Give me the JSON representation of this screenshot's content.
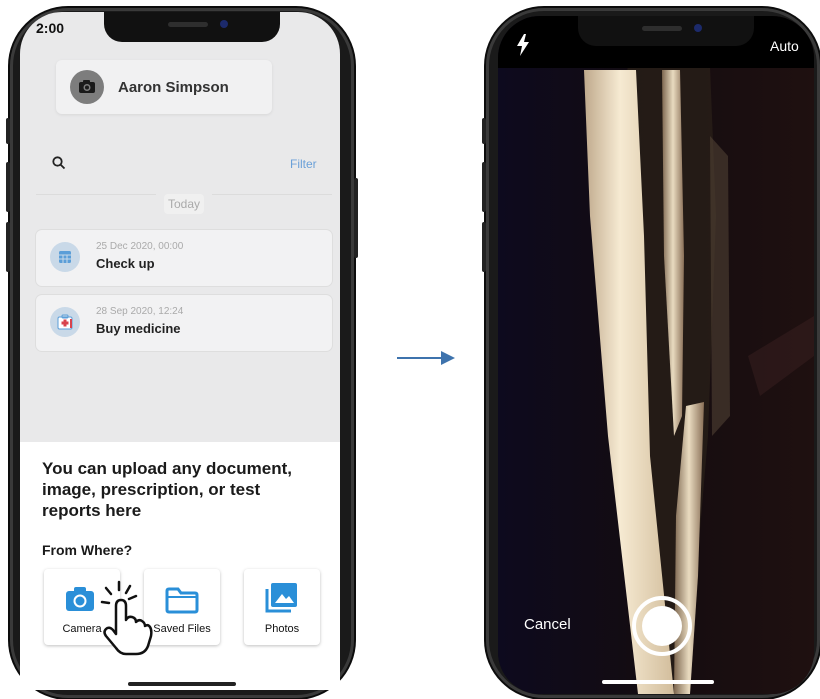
{
  "left_screen": {
    "status_time": "2:00",
    "profile": {
      "name": "Aaron Simpson",
      "avatar_icon": "camera-icon"
    },
    "search": {
      "icon": "search-icon",
      "filter_label": "Filter"
    },
    "section_label": "Today",
    "events": [
      {
        "date": "25 Dec 2020, 00:00",
        "title": "Check up",
        "icon": "calendar-icon"
      },
      {
        "date": "28 Sep 2020, 12:24",
        "title": "Buy medicine",
        "icon": "first-aid-kit-icon"
      }
    ],
    "upload_sheet": {
      "message": "You can upload any document, image, prescription, or test reports here",
      "prompt": "From Where?",
      "options": [
        {
          "label": "Camera",
          "icon": "camera-icon"
        },
        {
          "label": "Saved Files",
          "icon": "folder-icon"
        },
        {
          "label": "Photos",
          "icon": "photos-icon"
        }
      ]
    },
    "gesture": "tap-hand-icon"
  },
  "right_screen": {
    "flash_icon": "flash-icon",
    "flash_mode": "Auto",
    "cancel_label": "Cancel",
    "shutter_icon": "shutter-button"
  },
  "colors": {
    "accent_blue": "#2a8fd8",
    "filter_link": "#6aa0d8",
    "overlay_gray": "#e9e9ea"
  }
}
